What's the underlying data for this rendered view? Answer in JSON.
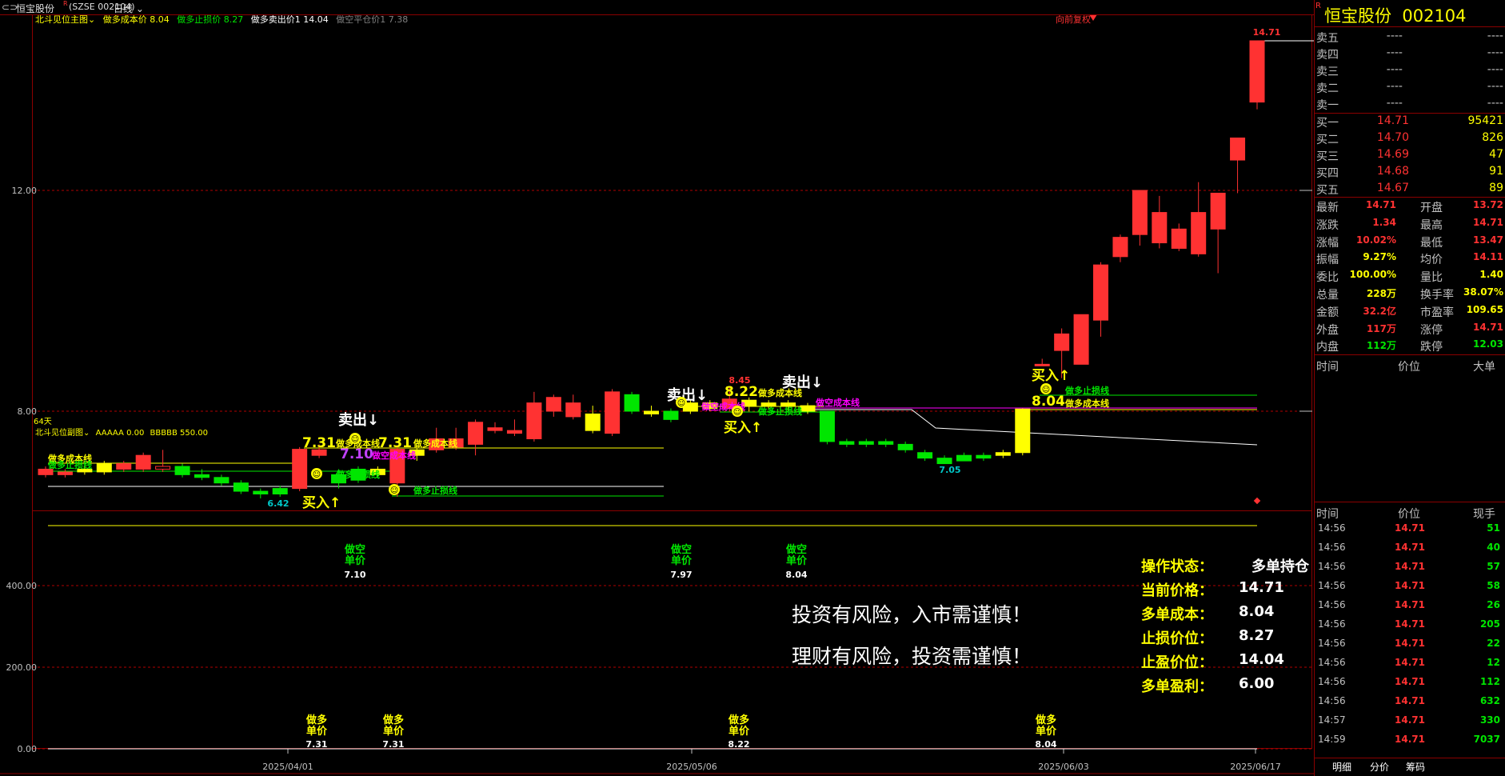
{
  "header": {
    "stock_title": "恒宝股份",
    "superscript": "R",
    "code": "(SZSE 002104)",
    "period": "日线"
  },
  "main_indicator": {
    "name": "北斗见位主图",
    "items": [
      {
        "label": "做多成本价",
        "value": "8.04",
        "color": "#ffff00"
      },
      {
        "label": "做多止损价",
        "value": "8.27",
        "color": "#00e600"
      },
      {
        "label": "做多卖出价1",
        "value": "14.04",
        "color": "#ffffff"
      },
      {
        "label": "做空平仓价1",
        "value": "7.38",
        "color": "#808080"
      }
    ],
    "right_label": "向前复权",
    "days_label": "64天"
  },
  "sub_indicator": {
    "name": "北斗见位副图",
    "items": [
      {
        "label": "AAAAA",
        "value": "0.00"
      },
      {
        "label": "BBBBB",
        "value": "550.00"
      }
    ]
  },
  "price_axis": {
    "ticks": [
      "12.00",
      "8.00"
    ]
  },
  "sub_axis": {
    "ticks": [
      "400.00",
      "200.00",
      "0.00"
    ]
  },
  "date_axis": {
    "ticks": [
      "2025/04/01",
      "2025/05/06",
      "2025/06/03",
      "2025/06/17"
    ]
  },
  "chart_data": {
    "type": "candlestick",
    "price_labels": {
      "high": "14.71",
      "low1": "6.42",
      "low2": "7.05",
      "peak_mid": "8.45"
    },
    "candles": [
      {
        "o": 6.95,
        "c": 6.85,
        "h": 7.0,
        "l": 6.8
      },
      {
        "o": 6.85,
        "c": 6.9,
        "h": 6.95,
        "l": 6.8
      },
      {
        "o": 6.9,
        "c": 6.95,
        "h": 7.0,
        "l": 6.85
      },
      {
        "o": 6.9,
        "c": 7.05,
        "h": 7.1,
        "l": 6.85
      },
      {
        "o": 6.95,
        "c": 7.05,
        "h": 7.1,
        "l": 6.9
      },
      {
        "o": 6.95,
        "c": 7.2,
        "h": 7.25,
        "l": 6.9
      },
      {
        "o": 7.0,
        "c": 6.95,
        "h": 7.3,
        "l": 6.9
      },
      {
        "o": 7.0,
        "c": 6.85,
        "h": 7.05,
        "l": 6.8
      },
      {
        "o": 6.85,
        "c": 6.8,
        "h": 6.95,
        "l": 6.75
      },
      {
        "o": 6.8,
        "c": 6.7,
        "h": 6.85,
        "l": 6.65
      },
      {
        "o": 6.7,
        "c": 6.55,
        "h": 6.75,
        "l": 6.5
      },
      {
        "o": 6.55,
        "c": 6.5,
        "h": 6.6,
        "l": 6.42
      },
      {
        "o": 6.5,
        "c": 6.6,
        "h": 6.65,
        "l": 6.45
      },
      {
        "o": 6.6,
        "c": 7.31,
        "h": 7.35,
        "l": 6.55
      },
      {
        "o": 7.2,
        "c": 7.3,
        "h": 7.4,
        "l": 7.15
      },
      {
        "o": 6.85,
        "c": 6.7,
        "h": 6.95,
        "l": 6.6
      },
      {
        "o": 6.95,
        "c": 6.75,
        "h": 7.0,
        "l": 6.7
      },
      {
        "o": 6.95,
        "c": 6.85,
        "h": 7.0,
        "l": 6.8
      },
      {
        "o": 6.7,
        "c": 7.31,
        "h": 7.35,
        "l": 6.45
      },
      {
        "o": 7.2,
        "c": 7.3,
        "h": 7.35,
        "l": 7.1
      },
      {
        "o": 7.3,
        "c": 7.5,
        "h": 7.7,
        "l": 7.25
      },
      {
        "o": 7.35,
        "c": 7.5,
        "h": 7.7,
        "l": 7.3
      },
      {
        "o": 7.4,
        "c": 7.8,
        "h": 7.85,
        "l": 7.2
      },
      {
        "o": 7.65,
        "c": 7.7,
        "h": 7.8,
        "l": 7.6
      },
      {
        "o": 7.6,
        "c": 7.65,
        "h": 7.85,
        "l": 7.55
      },
      {
        "o": 7.5,
        "c": 8.15,
        "h": 8.35,
        "l": 7.45
      },
      {
        "o": 8.0,
        "c": 8.25,
        "h": 8.3,
        "l": 7.9
      },
      {
        "o": 7.9,
        "c": 8.15,
        "h": 8.3,
        "l": 7.85
      },
      {
        "o": 7.65,
        "c": 7.95,
        "h": 8.1,
        "l": 7.6
      },
      {
        "o": 7.6,
        "c": 8.35,
        "h": 8.4,
        "l": 7.55
      },
      {
        "o": 8.3,
        "c": 8.0,
        "h": 8.35,
        "l": 7.95
      },
      {
        "o": 8.0,
        "c": 7.95,
        "h": 8.1,
        "l": 7.9
      },
      {
        "o": 8.0,
        "c": 7.85,
        "h": 8.05,
        "l": 7.8
      },
      {
        "o": 8.15,
        "c": 8.0,
        "h": 8.2,
        "l": 7.95
      },
      {
        "o": 8.15,
        "c": 8.05,
        "h": 8.2,
        "l": 8.0
      },
      {
        "o": 8.05,
        "c": 8.22,
        "h": 8.45,
        "l": 8.0
      },
      {
        "o": 8.2,
        "c": 8.1,
        "h": 8.25,
        "l": 8.0
      },
      {
        "o": 8.1,
        "c": 8.15,
        "h": 8.2,
        "l": 8.05
      },
      {
        "o": 8.15,
        "c": 8.1,
        "h": 8.2,
        "l": 8.0
      },
      {
        "o": 8.1,
        "c": 8.0,
        "h": 8.15,
        "l": 7.95
      },
      {
        "o": 8.0,
        "c": 7.45,
        "h": 8.0,
        "l": 7.4
      },
      {
        "o": 7.45,
        "c": 7.4,
        "h": 7.5,
        "l": 7.35
      },
      {
        "o": 7.45,
        "c": 7.4,
        "h": 7.5,
        "l": 7.35
      },
      {
        "o": 7.45,
        "c": 7.4,
        "h": 7.5,
        "l": 7.35
      },
      {
        "o": 7.4,
        "c": 7.3,
        "h": 7.45,
        "l": 7.25
      },
      {
        "o": 7.25,
        "c": 7.15,
        "h": 7.3,
        "l": 7.1
      },
      {
        "o": 7.15,
        "c": 7.05,
        "h": 7.2,
        "l": 7.05
      },
      {
        "o": 7.2,
        "c": 7.1,
        "h": 7.25,
        "l": 7.1
      },
      {
        "o": 7.2,
        "c": 7.15,
        "h": 7.25,
        "l": 7.1
      },
      {
        "o": 7.2,
        "c": 7.25,
        "h": 7.3,
        "l": 7.15
      },
      {
        "o": 7.25,
        "c": 8.04,
        "h": 8.05,
        "l": 7.2
      },
      {
        "o": 8.85,
        "c": 8.85,
        "h": 8.95,
        "l": 8.85
      },
      {
        "o": 9.4,
        "c": 9.1,
        "h": 9.5,
        "l": 8.6
      },
      {
        "o": 8.85,
        "c": 9.75,
        "h": 9.75,
        "l": 8.85
      },
      {
        "o": 9.65,
        "c": 10.65,
        "h": 10.7,
        "l": 9.35
      },
      {
        "o": 10.8,
        "c": 11.15,
        "h": 11.2,
        "l": 10.7
      },
      {
        "o": 11.2,
        "c": 12.0,
        "h": 12.0,
        "l": 11.0
      },
      {
        "o": 11.05,
        "c": 11.6,
        "h": 11.9,
        "l": 10.95
      },
      {
        "o": 10.95,
        "c": 11.3,
        "h": 11.4,
        "l": 10.9
      },
      {
        "o": 10.85,
        "c": 11.6,
        "h": 12.15,
        "l": 10.8
      },
      {
        "o": 11.3,
        "c": 11.95,
        "h": 11.95,
        "l": 10.5
      },
      {
        "o": 12.55,
        "c": 12.95,
        "h": 12.95,
        "l": 11.95
      },
      {
        "o": 13.6,
        "c": 14.71,
        "h": 14.71,
        "l": 13.47
      }
    ],
    "candle_colors": [
      "up",
      "up",
      "yellow",
      "yellow",
      "up",
      "up",
      "up",
      "down",
      "down",
      "down",
      "down",
      "down",
      "down",
      "up",
      "up",
      "down",
      "down",
      "yellow",
      "up",
      "yellow",
      "up",
      "up",
      "up",
      "up",
      "up",
      "up",
      "up",
      "up",
      "yellow",
      "up",
      "down",
      "yellow",
      "down",
      "yellow",
      "yellow",
      "up",
      "yellow",
      "yellow",
      "yellow",
      "yellow",
      "down",
      "down",
      "down",
      "down",
      "down",
      "down",
      "down",
      "down",
      "down",
      "yellow",
      "yellow",
      "up",
      "up",
      "up",
      "up",
      "up",
      "up",
      "up",
      "up",
      "up",
      "up",
      "up",
      "up"
    ],
    "ylim": [
      6.0,
      15.2
    ]
  },
  "annotations": {
    "sell1": "卖出↓",
    "sell2": "卖出↓",
    "sell3": "卖出↓",
    "buy1": "买入↑",
    "buy2": "买入↑",
    "buy3": "买入↑",
    "p731a": "7.31",
    "p731b": "7.31",
    "p710": "7.10",
    "p822": "8.22",
    "p804": "8.04",
    "long_cost_line": "做多成本线",
    "long_stop_line": "做多止损线",
    "short_cost_line": "做空成本线"
  },
  "sub_labels": {
    "short_price": "做空\n单价",
    "long_price": "做多\n单价",
    "short_values": [
      "7.10",
      "7.97",
      "8.04"
    ],
    "long_values": [
      "7.31",
      "7.31",
      "8.22",
      "8.04"
    ]
  },
  "warnings": [
    "投资有风险，入市需谨慎！",
    "理财有风险，投资需谨慎！"
  ],
  "status_panel": [
    {
      "label": "操作状态：",
      "value": "多单持仓"
    },
    {
      "label": "当前价格：",
      "value": "14.71"
    },
    {
      "label": "多单成本：",
      "value": "8.04"
    },
    {
      "label": "止损价位：",
      "value": "8.27"
    },
    {
      "label": "止盈价位：",
      "value": "14.04"
    },
    {
      "label": "多单盈利：",
      "value": "6.00"
    }
  ],
  "side_panel": {
    "title": "恒宝股份",
    "code": "002104",
    "superscript": "R",
    "asks": [
      {
        "label": "卖五",
        "price": "----",
        "vol": "----"
      },
      {
        "label": "卖四",
        "price": "----",
        "vol": "----"
      },
      {
        "label": "卖三",
        "price": "----",
        "vol": "----"
      },
      {
        "label": "卖二",
        "price": "----",
        "vol": "----"
      },
      {
        "label": "卖一",
        "price": "----",
        "vol": "----"
      }
    ],
    "bids": [
      {
        "label": "买一",
        "price": "14.71",
        "vol": "95421"
      },
      {
        "label": "买二",
        "price": "14.70",
        "vol": "826"
      },
      {
        "label": "买三",
        "price": "14.69",
        "vol": "47"
      },
      {
        "label": "买四",
        "price": "14.68",
        "vol": "91"
      },
      {
        "label": "买五",
        "price": "14.67",
        "vol": "89"
      }
    ],
    "stats": [
      {
        "l1": "最新",
        "v1": "14.71",
        "c1": "red",
        "l2": "开盘",
        "v2": "13.72",
        "c2": "red"
      },
      {
        "l1": "涨跌",
        "v1": "1.34",
        "c1": "red",
        "l2": "最高",
        "v2": "14.71",
        "c2": "red"
      },
      {
        "l1": "涨幅",
        "v1": "10.02%",
        "c1": "red",
        "l2": "最低",
        "v2": "13.47",
        "c2": "red"
      },
      {
        "l1": "振幅",
        "v1": "9.27%",
        "c1": "yellow",
        "l2": "均价",
        "v2": "14.11",
        "c2": "red"
      },
      {
        "l1": "委比",
        "v1": "100.00%",
        "c1": "yellow",
        "l2": "量比",
        "v2": "1.40",
        "c2": "yellow"
      },
      {
        "l1": "总量",
        "v1": "228万",
        "c1": "yellow",
        "l2": "换手率",
        "v2": "38.07%",
        "c2": "yellow"
      },
      {
        "l1": "金额",
        "v1": "32.2亿",
        "c1": "red",
        "l2": "市盈率",
        "v2": "109.65",
        "c2": "yellow"
      },
      {
        "l1": "外盘",
        "v1": "117万",
        "c1": "red",
        "l2": "涨停",
        "v2": "14.71",
        "c2": "red"
      },
      {
        "l1": "内盘",
        "v1": "112万",
        "c1": "green",
        "l2": "跌停",
        "v2": "12.03",
        "c2": "green"
      }
    ],
    "block_header": {
      "time": "时间",
      "price": "价位",
      "big": "大单"
    },
    "tick_header": {
      "time": "时间",
      "price": "价位",
      "vol": "现手"
    },
    "ticks": [
      {
        "time": "14:56",
        "price": "14.71",
        "vol": "51"
      },
      {
        "time": "14:56",
        "price": "14.71",
        "vol": "40"
      },
      {
        "time": "14:56",
        "price": "14.71",
        "vol": "57"
      },
      {
        "time": "14:56",
        "price": "14.71",
        "vol": "58"
      },
      {
        "time": "14:56",
        "price": "14.71",
        "vol": "26"
      },
      {
        "time": "14:56",
        "price": "14.71",
        "vol": "205"
      },
      {
        "time": "14:56",
        "price": "14.71",
        "vol": "22"
      },
      {
        "time": "14:56",
        "price": "14.71",
        "vol": "12"
      },
      {
        "time": "14:56",
        "price": "14.71",
        "vol": "112"
      },
      {
        "time": "14:56",
        "price": "14.71",
        "vol": "632"
      },
      {
        "time": "14:57",
        "price": "14.71",
        "vol": "330"
      },
      {
        "time": "14:59",
        "price": "14.71",
        "vol": "7037"
      }
    ],
    "tabs": [
      "明细",
      "分价",
      "筹码"
    ]
  },
  "colors": {
    "up": "#ff3232",
    "down": "#00e600",
    "yellow": "#ffff00",
    "grid": "#8b0000"
  }
}
